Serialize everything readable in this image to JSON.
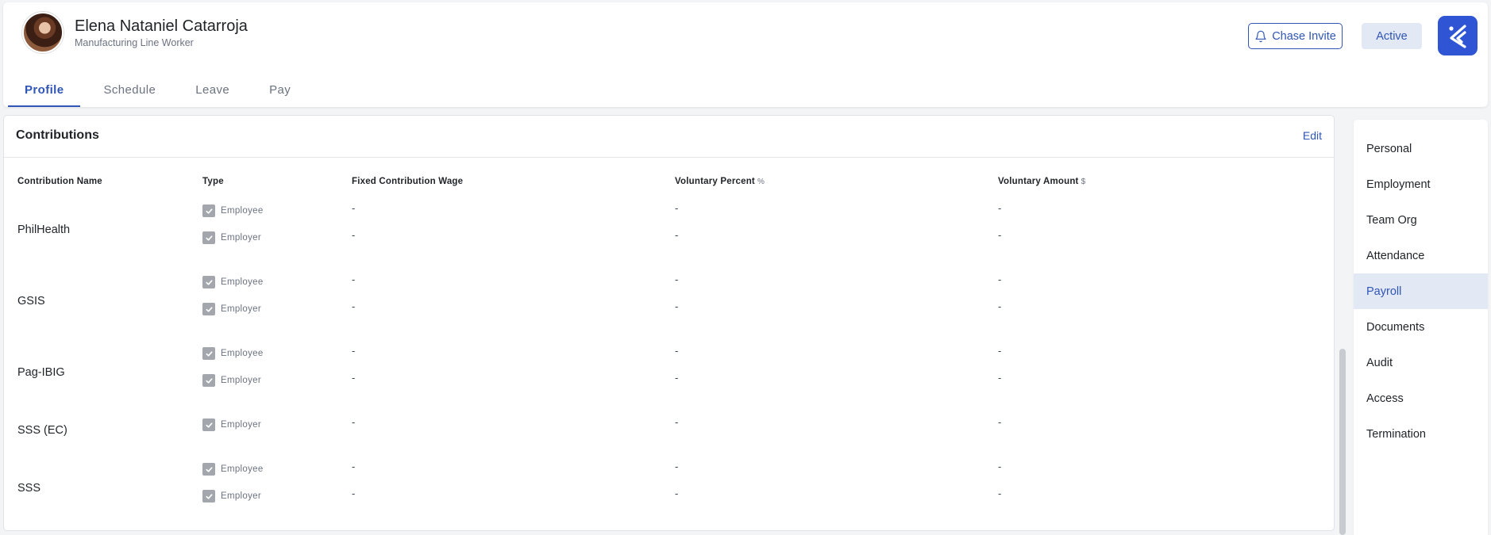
{
  "employee": {
    "name": "Elena Nataniel Catarroja",
    "title": "Manufacturing Line Worker"
  },
  "header": {
    "chase_invite_label": "Chase Invite",
    "status_label": "Active"
  },
  "tabs": [
    {
      "label": "Profile",
      "active": true
    },
    {
      "label": "Schedule",
      "active": false
    },
    {
      "label": "Leave",
      "active": false
    },
    {
      "label": "Pay",
      "active": false
    }
  ],
  "contributions": {
    "title": "Contributions",
    "edit_label": "Edit",
    "columns": {
      "name": "Contribution Name",
      "type": "Type",
      "fixed_wage": "Fixed Contribution Wage",
      "voluntary_percent": "Voluntary Percent",
      "voluntary_percent_unit": "%",
      "voluntary_amount": "Voluntary Amount",
      "voluntary_amount_unit": "$"
    },
    "rows": [
      {
        "name": "PhilHealth",
        "types": [
          {
            "type": "Employee",
            "checked": true,
            "fixed_wage": "-",
            "voluntary_percent": "-",
            "voluntary_amount": "-"
          },
          {
            "type": "Employer",
            "checked": true,
            "fixed_wage": "-",
            "voluntary_percent": "-",
            "voluntary_amount": "-"
          }
        ]
      },
      {
        "name": "GSIS",
        "types": [
          {
            "type": "Employee",
            "checked": true,
            "fixed_wage": "-",
            "voluntary_percent": "-",
            "voluntary_amount": "-"
          },
          {
            "type": "Employer",
            "checked": true,
            "fixed_wage": "-",
            "voluntary_percent": "-",
            "voluntary_amount": "-"
          }
        ]
      },
      {
        "name": "Pag-IBIG",
        "types": [
          {
            "type": "Employee",
            "checked": true,
            "fixed_wage": "-",
            "voluntary_percent": "-",
            "voluntary_amount": "-"
          },
          {
            "type": "Employer",
            "checked": true,
            "fixed_wage": "-",
            "voluntary_percent": "-",
            "voluntary_amount": "-"
          }
        ]
      },
      {
        "name": "SSS (EC)",
        "types": [
          {
            "type": "Employer",
            "checked": true,
            "fixed_wage": "-",
            "voluntary_percent": "-",
            "voluntary_amount": "-"
          }
        ]
      },
      {
        "name": "SSS",
        "types": [
          {
            "type": "Employee",
            "checked": true,
            "fixed_wage": "-",
            "voluntary_percent": "-",
            "voluntary_amount": "-"
          },
          {
            "type": "Employer",
            "checked": true,
            "fixed_wage": "-",
            "voluntary_percent": "-",
            "voluntary_amount": "-"
          }
        ]
      }
    ]
  },
  "side_nav": [
    {
      "label": "Personal",
      "active": false
    },
    {
      "label": "Employment",
      "active": false
    },
    {
      "label": "Team Org",
      "active": false
    },
    {
      "label": "Attendance",
      "active": false
    },
    {
      "label": "Payroll",
      "active": true
    },
    {
      "label": "Documents",
      "active": false
    },
    {
      "label": "Audit",
      "active": false
    },
    {
      "label": "Access",
      "active": false
    },
    {
      "label": "Termination",
      "active": false
    }
  ],
  "colors": {
    "accent": "#2f55b6",
    "logo_bg": "#2f55d4",
    "active_bg": "#e3e8f5"
  },
  "icons": {
    "chase_invite": "bell-icon",
    "logo": "company-logo-icon",
    "checkbox": "checkbox-checked-icon"
  }
}
